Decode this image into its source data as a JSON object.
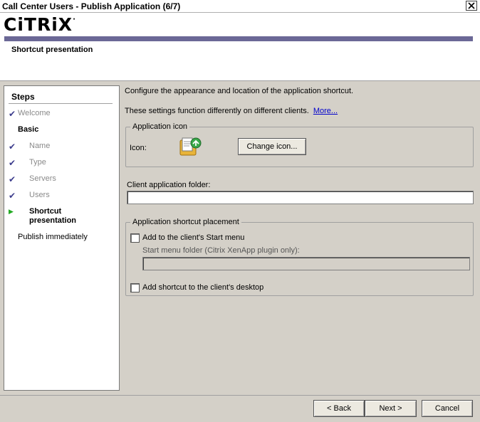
{
  "window": {
    "title": "Call Center Users - Publish Application (6/7)",
    "close_icon": "close-icon"
  },
  "header": {
    "logo_text": "CiTRiX",
    "logo_mark": "·",
    "subtitle": "Shortcut presentation",
    "brand_color": "#6b6896"
  },
  "steps": {
    "heading": "Steps",
    "items": [
      {
        "label": "Welcome",
        "state": "done"
      },
      {
        "label": "Basic",
        "state": "section"
      },
      {
        "label": "Name",
        "state": "done"
      },
      {
        "label": "Type",
        "state": "done"
      },
      {
        "label": "Servers",
        "state": "done"
      },
      {
        "label": "Users",
        "state": "done"
      },
      {
        "label": "Shortcut presentation",
        "state": "current"
      },
      {
        "label": "Publish immediately",
        "state": "pending"
      }
    ]
  },
  "main": {
    "intro": "Configure the appearance and location of the application shortcut.",
    "note": "These settings function differently on different clients.",
    "more_link": "More...",
    "app_icon_group": {
      "legend": "Application icon",
      "icon_label": "Icon:",
      "change_button": "Change icon..."
    },
    "client_folder": {
      "label": "Client application folder:",
      "value": ""
    },
    "placement_group": {
      "legend": "Application shortcut placement",
      "start_menu_checkbox": {
        "label": "Add to the client's Start menu",
        "checked": false
      },
      "start_menu_folder": {
        "label": "Start menu folder (Citrix XenApp plugin only):",
        "value": "",
        "disabled": true
      },
      "desktop_checkbox": {
        "label": "Add shortcut to the client's desktop",
        "checked": false
      }
    }
  },
  "footer": {
    "back": "< Back",
    "next": "Next >",
    "cancel": "Cancel"
  }
}
